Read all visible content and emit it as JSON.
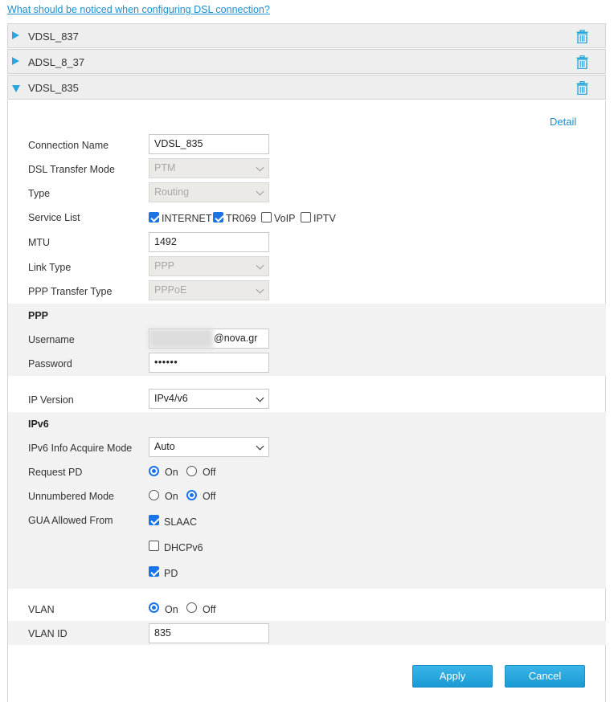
{
  "help_link": "What should be noticed when configuring DSL connection?",
  "connections": [
    {
      "name": "VDSL_837",
      "expanded": false
    },
    {
      "name": "ADSL_8_37",
      "expanded": false
    },
    {
      "name": "VDSL_835",
      "expanded": true
    }
  ],
  "icons": {
    "expand": "triangle-right-icon",
    "collapse": "triangle-down-icon",
    "delete": "trash-icon"
  },
  "colors": {
    "accent": "#2aa6dc",
    "link": "#1a8fd0",
    "checked": "#1a73e8",
    "button": "#1a9ad4"
  },
  "form": {
    "detail_link": "Detail",
    "connection_name": {
      "label": "Connection Name",
      "value": "VDSL_835"
    },
    "dsl_transfer_mode": {
      "label": "DSL Transfer Mode",
      "value": "PTM"
    },
    "type": {
      "label": "Type",
      "value": "Routing"
    },
    "service_list": {
      "label": "Service List",
      "options": [
        {
          "label": "INTERNET",
          "checked": true
        },
        {
          "label": "TR069",
          "checked": true
        },
        {
          "label": "VoIP",
          "checked": false
        },
        {
          "label": "IPTV",
          "checked": false
        }
      ]
    },
    "mtu": {
      "label": "MTU",
      "value": "1492"
    },
    "link_type": {
      "label": "Link Type",
      "value": "PPP"
    },
    "ppp_transfer_type": {
      "label": "PPP Transfer Type",
      "value": "PPPoE"
    },
    "ppp": {
      "title": "PPP",
      "username": {
        "label": "Username",
        "value": "@nova.gr"
      },
      "password": {
        "label": "Password",
        "value": "••••••"
      }
    },
    "ip_version": {
      "label": "IP Version",
      "value": "IPv4/v6"
    },
    "ipv6": {
      "title": "IPv6",
      "acquire_mode": {
        "label": "IPv6 Info Acquire Mode",
        "value": "Auto"
      },
      "request_pd": {
        "label": "Request PD",
        "on": "On",
        "off": "Off",
        "selected": "On"
      },
      "unnumbered_mode": {
        "label": "Unnumbered Mode",
        "on": "On",
        "off": "Off",
        "selected": "Off"
      },
      "gua_allowed_from": {
        "label": "GUA Allowed From",
        "options": [
          {
            "label": "SLAAC",
            "checked": true
          },
          {
            "label": "DHCPv6",
            "checked": false
          },
          {
            "label": "PD",
            "checked": true
          }
        ]
      }
    },
    "vlan": {
      "label": "VLAN",
      "on": "On",
      "off": "Off",
      "selected": "On"
    },
    "vlan_id": {
      "label": "VLAN ID",
      "value": "835"
    },
    "apply_label": "Apply",
    "cancel_label": "Cancel"
  }
}
